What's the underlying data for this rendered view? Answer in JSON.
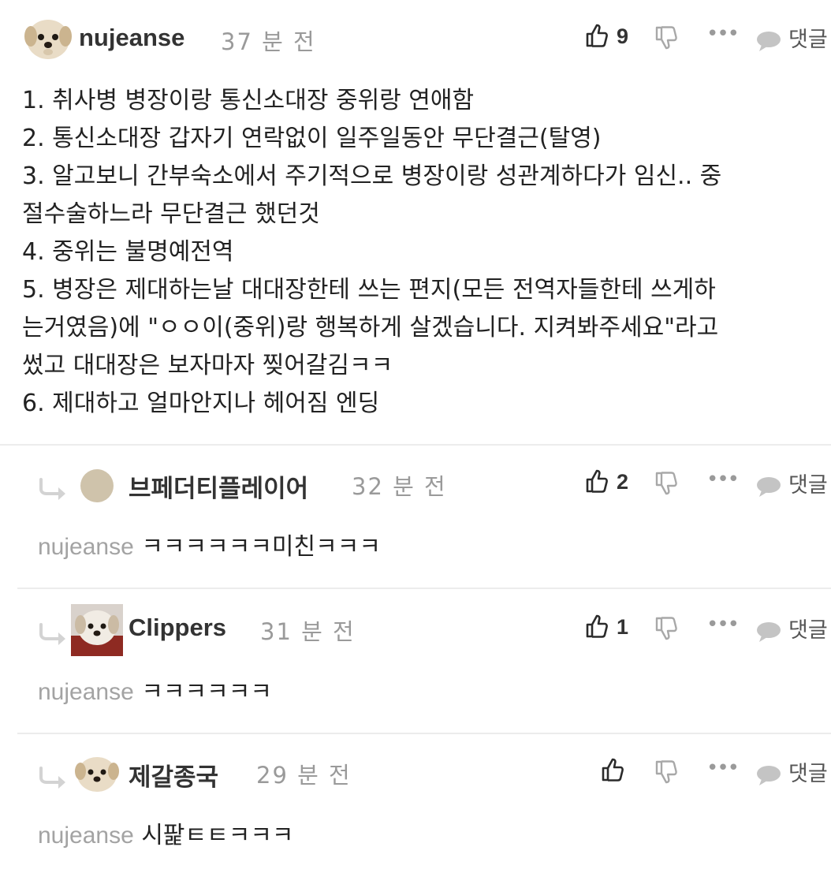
{
  "post": {
    "author": "nujeanse",
    "time": "37 분 전",
    "likes": "9",
    "reply_label": "댓글",
    "lines": [
      "1. 취사병 병장이랑 통신소대장 중위랑 연애함",
      "2. 통신소대장 갑자기 연락없이 일주일동안 무단결근(탈영)",
      "3. 알고보니 간부숙소에서 주기적으로 병장이랑 성관계하다가 임신.. 중",
      "절수술하느라 무단결근 했던것",
      "4. 중위는 불명예전역",
      "5. 병장은 제대하는날 대대장한테 쓰는 편지(모든 전역자들한테 쓰게하",
      "는거였음)에 \"ㅇㅇ이(중위)랑 행복하게 살겠습니다. 지켜봐주세요\"라고",
      "썼고 대대장은 보자마자 찢어갈김ㅋㅋ",
      "6. 제대하고 얼마안지나 헤어짐 엔딩"
    ]
  },
  "replies": [
    {
      "author": "브페더티플레이어",
      "time": "32 분 전",
      "likes": "2",
      "mention": "nujeanse",
      "text": "ㅋㅋㅋㅋㅋㅋ미친ㅋㅋㅋ",
      "reply_label": "댓글"
    },
    {
      "author": "Clippers",
      "time": "31 분 전",
      "likes": "1",
      "mention": "nujeanse",
      "text": "ㅋㅋㅋㅋㅋㅋ",
      "reply_label": "댓글"
    },
    {
      "author": "제갈종국",
      "time": "29 분 전",
      "likes": "",
      "mention": "nujeanse",
      "text": "시팙ㅌㅌㅋㅋㅋ",
      "reply_label": "댓글"
    }
  ],
  "icons": {
    "like": "thumbs-up-icon",
    "dislike": "thumbs-down-icon",
    "more": "more-dots-icon",
    "reply": "speech-bubble-icon",
    "reply_arrow": "reply-arrow-icon"
  },
  "colors": {
    "text": "#222222",
    "muted": "#9a9a9a",
    "mention": "#a3a3a3",
    "divider": "#ececec"
  }
}
